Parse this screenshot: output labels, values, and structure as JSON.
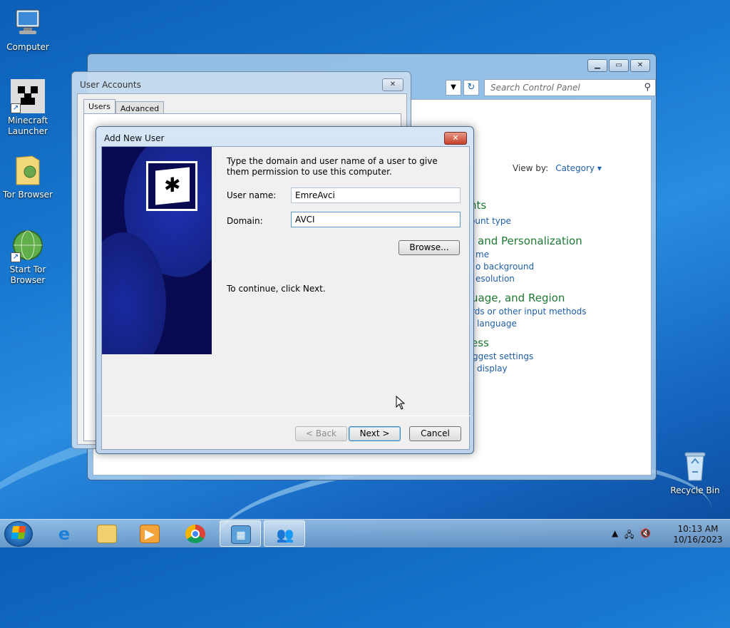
{
  "desktop": {
    "icons": [
      {
        "label": "Computer"
      },
      {
        "label": "Minecraft Launcher"
      },
      {
        "label": "Tor Browser"
      },
      {
        "label": "Start Tor Browser"
      },
      {
        "label": "Recycle Bin"
      }
    ]
  },
  "control_panel": {
    "search_placeholder": "Search Control Panel",
    "view_by_label": "View by:",
    "view_by_value": "Category ▾",
    "categories": [
      {
        "title": "nts",
        "links": [
          "ount type"
        ]
      },
      {
        "title": "and Personalization",
        "links": [
          "me",
          "o background",
          "esolution"
        ]
      },
      {
        "title": "uage, and Region",
        "links": [
          "rds or other input methods",
          "language"
        ]
      },
      {
        "title": "ess",
        "links": [
          "ggest settings",
          "display"
        ]
      }
    ]
  },
  "user_accounts": {
    "title": "User Accounts",
    "tabs": [
      "Users",
      "Advanced"
    ]
  },
  "add_new_user": {
    "title": "Add New User",
    "instruction": "Type the domain and user name of a user to give them permission to use this computer.",
    "username_label": "User name:",
    "username_value": "EmreAvci",
    "domain_label": "Domain:",
    "domain_value": "AVCI",
    "browse_label": "Browse...",
    "continue_text": "To continue, click Next.",
    "back_label": "< Back",
    "next_label": "Next >",
    "cancel_label": "Cancel"
  },
  "taskbar": {
    "time": "10:13 AM",
    "date": "10/16/2023"
  }
}
